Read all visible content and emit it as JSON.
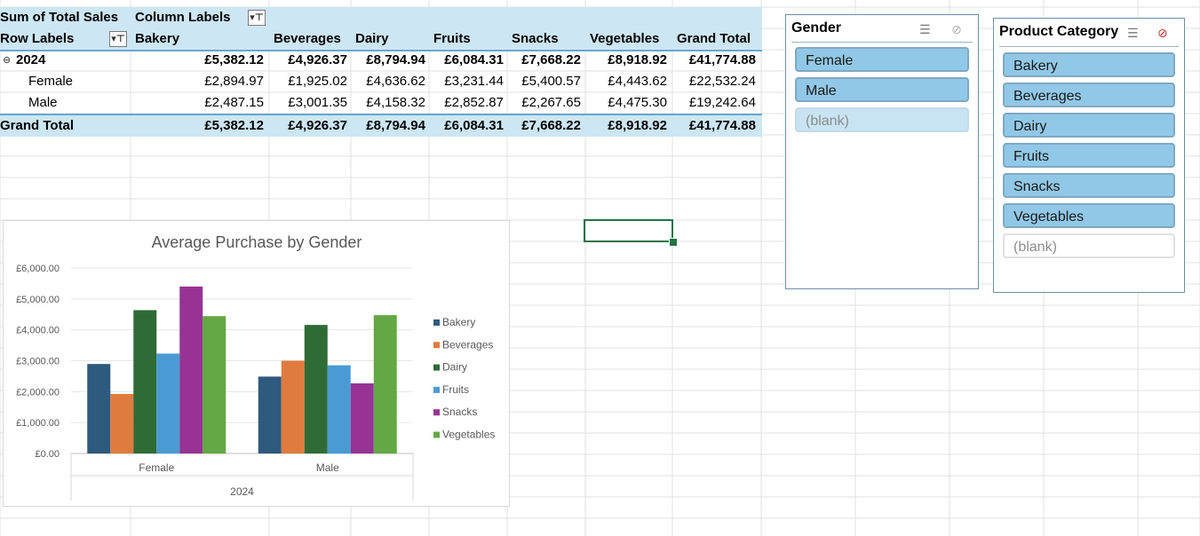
{
  "pivot": {
    "header_left": "Sum of Total Sales",
    "header_cols": "Column Labels",
    "row_labels": "Row Labels",
    "columns": [
      "Bakery",
      "Beverages",
      "Dairy",
      "Fruits",
      "Snacks",
      "Vegetables",
      "Grand Total"
    ],
    "rows": [
      {
        "label": "2024",
        "values": [
          "£5,382.12",
          "£4,926.37",
          "£8,794.94",
          "£6,084.31",
          "£7,668.22",
          "£8,918.92",
          "£41,774.88"
        ]
      },
      {
        "label": "Female",
        "values": [
          "£2,894.97",
          "£1,925.02",
          "£4,636.62",
          "£3,231.44",
          "£5,400.57",
          "£4,443.62",
          "£22,532.24"
        ]
      },
      {
        "label": "Male",
        "values": [
          "£2,487.15",
          "£3,001.35",
          "£4,158.32",
          "£2,852.87",
          "£2,267.65",
          "£4,475.30",
          "£19,242.64"
        ]
      },
      {
        "label": "Grand Total",
        "values": [
          "£5,382.12",
          "£4,926.37",
          "£8,794.94",
          "£6,084.31",
          "£7,668.22",
          "£8,918.92",
          "£41,774.88"
        ]
      }
    ],
    "expand_glyph": "⊖"
  },
  "slicers": {
    "gender": {
      "title": "Gender",
      "items": [
        {
          "label": "Female",
          "state": "sel"
        },
        {
          "label": "Male",
          "state": "sel"
        },
        {
          "label": "(blank)",
          "state": "dim"
        }
      ]
    },
    "category": {
      "title": "Product Category",
      "items": [
        {
          "label": "Bakery",
          "state": "sel"
        },
        {
          "label": "Beverages",
          "state": "sel"
        },
        {
          "label": "Dairy",
          "state": "sel"
        },
        {
          "label": "Fruits",
          "state": "sel"
        },
        {
          "label": "Snacks",
          "state": "sel"
        },
        {
          "label": "Vegetables",
          "state": "sel"
        },
        {
          "label": "(blank)",
          "state": "blank"
        }
      ]
    }
  },
  "colors": {
    "Bakery": "#2e5a7e",
    "Beverages": "#e07b3f",
    "Dairy": "#2f6b34",
    "Fruits": "#4a9bd4",
    "Snacks": "#963394",
    "Vegetables": "#63a844"
  },
  "chart_data": {
    "type": "bar",
    "title": "Average Purchase by Gender",
    "categories": [
      "Female",
      "Male"
    ],
    "group_label": "2024",
    "ylim": [
      0,
      6000
    ],
    "yticks": [
      "£0.00",
      "£1,000.00",
      "£2,000.00",
      "£3,000.00",
      "£4,000.00",
      "£5,000.00",
      "£6,000.00"
    ],
    "series": [
      {
        "name": "Bakery",
        "values": [
          2894.97,
          2487.15
        ]
      },
      {
        "name": "Beverages",
        "values": [
          1925.02,
          3001.35
        ]
      },
      {
        "name": "Dairy",
        "values": [
          4636.62,
          4158.32
        ]
      },
      {
        "name": "Fruits",
        "values": [
          3231.44,
          2852.87
        ]
      },
      {
        "name": "Snacks",
        "values": [
          5400.57,
          2267.65
        ]
      },
      {
        "name": "Vegetables",
        "values": [
          4443.62,
          4475.3
        ]
      }
    ],
    "legend": "right",
    "grid": true
  }
}
